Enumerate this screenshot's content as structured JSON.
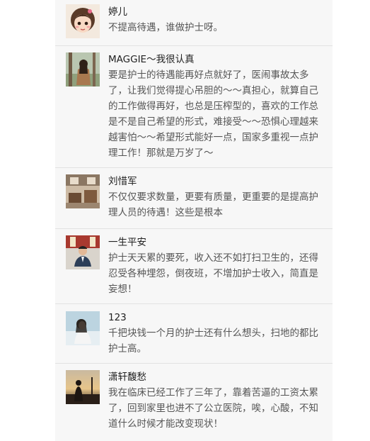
{
  "comments": [
    {
      "name": "婷儿",
      "avatar": "cartoon-girl-avatar",
      "lines": [
        "不提高待遇，谁做护士呀。"
      ]
    },
    {
      "name": "MAGGIE～我很认真",
      "avatar": "girl-by-tree-avatar",
      "lines": [
        "要是护士的待遇能再好点就好了，医闹事故太多",
        "了，让我们觉得提心吊胆的～～真担心，就算自己",
        "的工作做得再好，也总是压榨型的，喜欢的工作总",
        "是不是自己希望的形式，难接受～～恐惧心理越来",
        "越害怕～～希望形式能好一点，国家多重视一点护",
        "理工作！那就是万岁了～"
      ]
    },
    {
      "name": "刘惜军",
      "avatar": "room-interior-avatar",
      "lines": [
        "不仅仅要求数量，更要有质量，更重要的是提高护",
        "理人员的待遇！这些是根本"
      ]
    },
    {
      "name": "一生平安",
      "avatar": "man-portrait-avatar",
      "lines": [
        "护士天天累的要死，收入还不如打扫卫生的，还得",
        "忍受各种埋怨，倒夜班，不增加护士收入，简直是",
        "妄想！"
      ]
    },
    {
      "name": "123",
      "avatar": "woman-outdoors-avatar",
      "lines": [
        "千把块钱一个月的护士还有什么想头，扫地的都比",
        "护士高。"
      ]
    },
    {
      "name": "潇轩馥愁",
      "avatar": "sunset-silhouette-avatar",
      "lines": [
        "我在临床已经工作了三年了，靠着苦逼的工资太累",
        "了，回到家里也进不了公立医院，唉，心酸，不知",
        "道什么时候才能改变现状！"
      ]
    }
  ]
}
